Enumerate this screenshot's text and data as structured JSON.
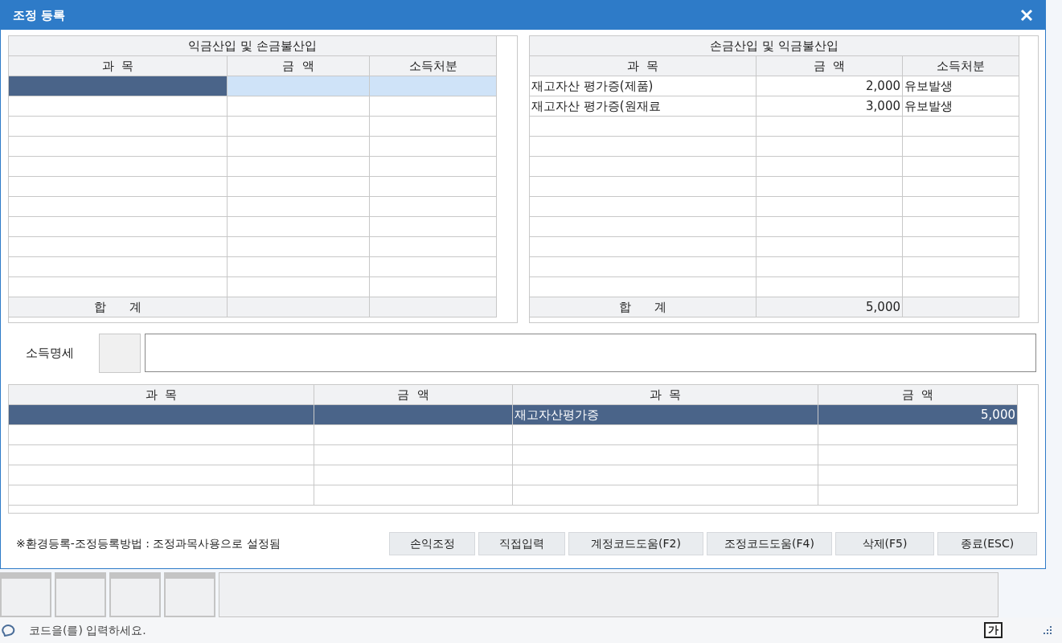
{
  "dialog": {
    "title": "조정 등록"
  },
  "left_table": {
    "title": "익금산입 및 손금불산입",
    "columns": [
      "과  목",
      "금  액",
      "소득처분"
    ],
    "total_label": "합      계",
    "rows": [
      {
        "selected": true
      },
      {
        "selected": false
      },
      {
        "selected": false
      },
      {
        "selected": false
      },
      {
        "selected": false
      },
      {
        "selected": false
      },
      {
        "selected": false
      },
      {
        "selected": false
      },
      {
        "selected": false
      },
      {
        "selected": false
      },
      {
        "selected": false
      }
    ]
  },
  "right_table": {
    "title": "손금산입 및 익금불산입",
    "columns": [
      "과  목",
      "금  액",
      "소득처분"
    ],
    "total_label": "합      계",
    "total_amount": "5,000",
    "rows": [
      {
        "subject": "재고자산 평가증(제품)",
        "amount": "2,000",
        "disposition": "유보발생",
        "selected": false
      },
      {
        "subject": "재고자산 평가증(원재료",
        "amount": "3,000",
        "disposition": "유보발생",
        "selected": false
      },
      {
        "selected": false
      },
      {
        "selected": false
      },
      {
        "selected": false
      },
      {
        "selected": false
      },
      {
        "selected": false
      },
      {
        "selected": false
      },
      {
        "selected": false
      },
      {
        "selected": false
      },
      {
        "selected": false
      }
    ]
  },
  "income_detail": {
    "label": "소득명세"
  },
  "detail_table": {
    "columns": [
      "과  목",
      "금  액",
      "과  목",
      "금  액"
    ],
    "rows": [
      {
        "cells": [
          "",
          "",
          "재고자산평가증",
          "5,000"
        ],
        "selected": true
      },
      {
        "cells": [],
        "selected": false
      },
      {
        "cells": [],
        "selected": false
      },
      {
        "cells": [],
        "selected": false
      },
      {
        "cells": [],
        "selected": false
      }
    ]
  },
  "note": "※환경등록-조정등록방법 : 조정과목사용으로 설정됨",
  "buttons": [
    "손익조정",
    "직접입력",
    "계정코드도움(F2)",
    "조정코드도움(F4)",
    "삭제(F5)",
    "종료(ESC)"
  ],
  "status_bar": {
    "message": "코드을(를) 입력하세요.",
    "ime_mode": "가"
  }
}
